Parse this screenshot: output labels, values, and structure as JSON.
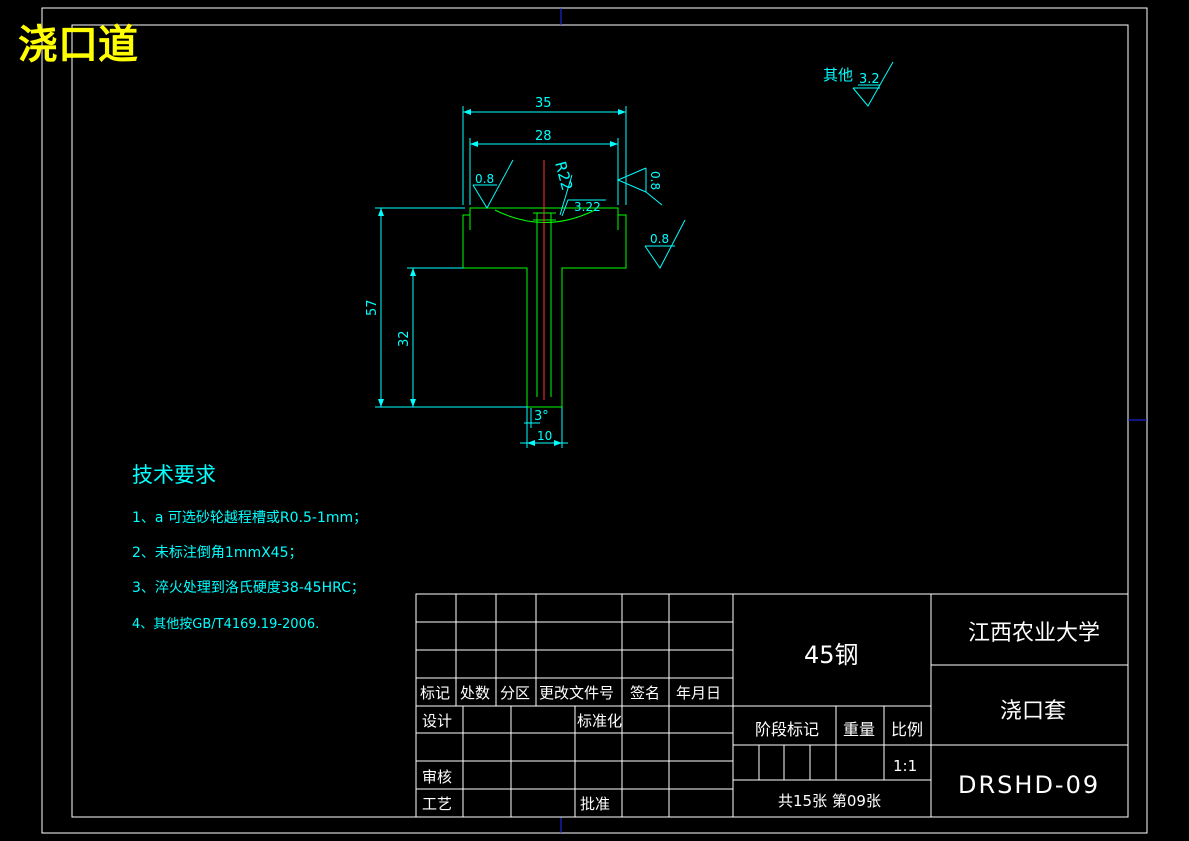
{
  "page_title": "浇口道",
  "roughness": {
    "other_label": "其他",
    "other_value": "3.2",
    "left_value": "0.8",
    "right_top_value": "0.8",
    "right_step_value": "0.8",
    "center_value": "3.22"
  },
  "dimensions": {
    "top_width": "35",
    "inner_width": "28",
    "radius": "R22",
    "overall_height": "57",
    "stem_height": "32",
    "taper_angle": "3°",
    "bottom_width": "10"
  },
  "tech_requirements": {
    "title": "技术要求",
    "items": [
      "1、a 可选砂轮越程槽或R0.5-1mm；",
      "2、未标注倒角1mmX45；",
      "3、淬火处理到洛氏硬度38-45HRC；",
      "4、其他按GB/T4169.19-2006."
    ]
  },
  "title_block": {
    "revision_headers": [
      "标记",
      "处数",
      "分区",
      "更改文件号",
      "签名",
      "年月日"
    ],
    "design": "设计",
    "standardization": "标准化",
    "review": "审核",
    "process": "工艺",
    "approve": "批准",
    "material": "45钢",
    "stage_mark": "阶段标记",
    "weight": "重量",
    "scale_label": "比例",
    "scale_value": "1:1",
    "sheet_info": "共15张 第09张",
    "school": "江西农业大学",
    "part_name": "浇口套",
    "drawing_no": "DRSHD-09"
  },
  "colors": {
    "background": "#000000",
    "frame": "#ffffff",
    "part_outline": "#00ff00",
    "dimension": "#00ffff",
    "centerline": "#ff0000",
    "title": "#ffff00",
    "axis_marker": "#0000ff"
  }
}
